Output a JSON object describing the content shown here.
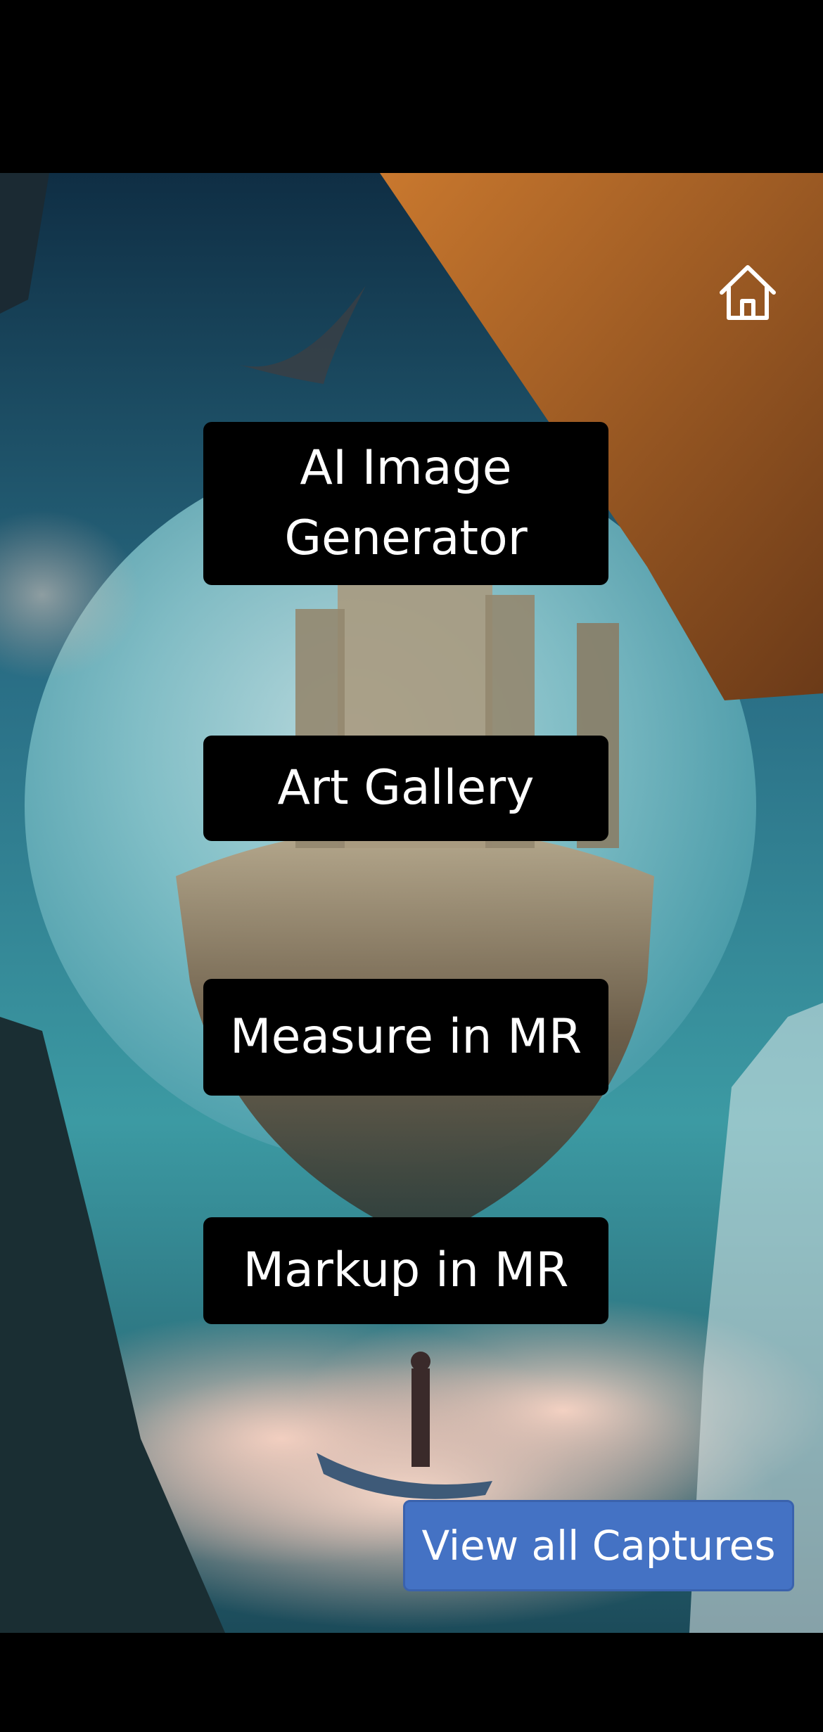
{
  "home": {
    "icon": "home-icon"
  },
  "menu": {
    "items": [
      {
        "label": "AI Image Generator"
      },
      {
        "label": "Art Gallery"
      },
      {
        "label": "Measure in MR"
      },
      {
        "label": "Markup in MR"
      }
    ]
  },
  "captures": {
    "label": "View all Captures"
  },
  "colors": {
    "button_bg": "#000000",
    "button_text": "#ffffff",
    "captures_bg": "#4472c4",
    "sky_top": "#12354a",
    "sky_mid": "#2e7c8c",
    "clouds": "#f2cdbf"
  }
}
